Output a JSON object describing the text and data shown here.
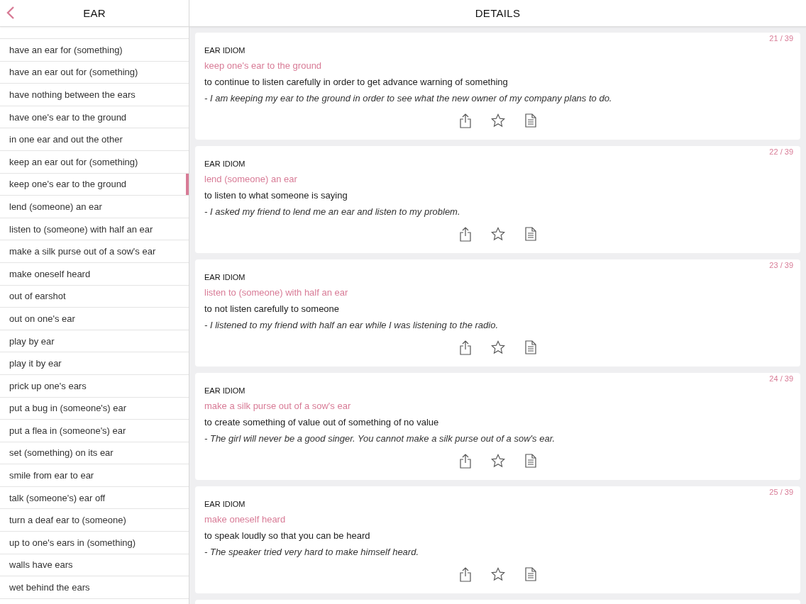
{
  "sidebar": {
    "title": "EAR",
    "items": [
      {
        "label": "have an ear for (something)",
        "selected": false
      },
      {
        "label": "have an ear out for (something)",
        "selected": false
      },
      {
        "label": "have nothing between the ears",
        "selected": false
      },
      {
        "label": "have one's ear to the ground",
        "selected": false
      },
      {
        "label": "in one ear and out the other",
        "selected": false
      },
      {
        "label": "keep an ear out for (something)",
        "selected": false
      },
      {
        "label": "keep one's ear to the ground",
        "selected": true
      },
      {
        "label": "lend (someone) an ear",
        "selected": false
      },
      {
        "label": "listen to (someone) with half an ear",
        "selected": false
      },
      {
        "label": "make a silk purse out of a sow's ear",
        "selected": false
      },
      {
        "label": "make oneself heard",
        "selected": false
      },
      {
        "label": "out of earshot",
        "selected": false
      },
      {
        "label": "out on one's ear",
        "selected": false
      },
      {
        "label": "play by ear",
        "selected": false
      },
      {
        "label": "play it by ear",
        "selected": false
      },
      {
        "label": "prick up one's ears",
        "selected": false
      },
      {
        "label": "put a bug in (someone's) ear",
        "selected": false
      },
      {
        "label": "put a flea in (someone's) ear",
        "selected": false
      },
      {
        "label": "set (something) on its ear",
        "selected": false
      },
      {
        "label": "smile from ear to ear",
        "selected": false
      },
      {
        "label": "talk (someone's) ear off",
        "selected": false
      },
      {
        "label": "turn a deaf ear to (someone)",
        "selected": false
      },
      {
        "label": "up to one's ears in (something)",
        "selected": false
      },
      {
        "label": "walls have ears",
        "selected": false
      },
      {
        "label": "wet behind the ears",
        "selected": false
      }
    ]
  },
  "details": {
    "title": "DETAILS",
    "cards": [
      {
        "counter": "21 / 39",
        "category": "EAR IDIOM",
        "idiom": "keep one's ear to the ground",
        "meaning": "to continue to listen carefully in order to get advance warning of something",
        "example": "- I am keeping my ear to the ground in order to see what the new owner of my company plans to do."
      },
      {
        "counter": "22 / 39",
        "category": "EAR IDIOM",
        "idiom": "lend (someone) an ear",
        "meaning": "to listen to what someone is saying",
        "example": "- I asked my friend to lend me an ear and listen to my problem."
      },
      {
        "counter": "23 / 39",
        "category": "EAR IDIOM",
        "idiom": "listen to (someone) with half an ear",
        "meaning": "to not listen carefully to someone",
        "example": "- I listened to my friend with half an ear while I was listening to the radio."
      },
      {
        "counter": "24 / 39",
        "category": "EAR IDIOM",
        "idiom": "make a silk purse out of a sow's ear",
        "meaning": "to create something of value out of something of no value",
        "example": "- The girl will never be a good singer. You cannot make a silk purse out of a sow's ear."
      },
      {
        "counter": "25 / 39",
        "category": "EAR IDIOM",
        "idiom": "make oneself heard",
        "meaning": "to speak loudly so that you can be heard",
        "example": "- The speaker tried very hard to make himself heard."
      }
    ]
  }
}
